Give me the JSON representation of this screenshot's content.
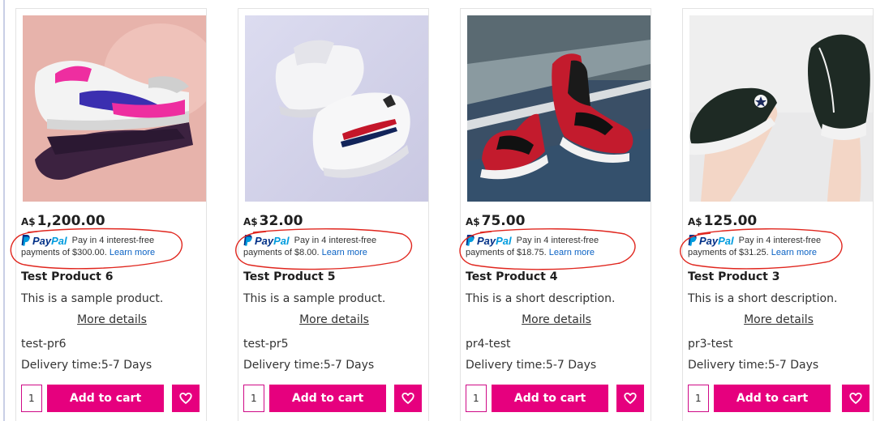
{
  "products": [
    {
      "price_currency": "A$",
      "price_amount": "1,200.00",
      "paypal_brand_pay": "Pay",
      "paypal_brand_pal": "Pal",
      "paypal_line1": "Pay in 4 interest-free",
      "paypal_line2": "payments of $300.00.",
      "paypal_learn": "Learn more",
      "name": "Test Product 6",
      "description": "This is a sample product.",
      "more_details": "More details",
      "sku": "test-pr6",
      "delivery": "Delivery time:5-7 Days",
      "quantity": "1",
      "add_to_cart": "Add to cart",
      "image": "pink-white-sneaker-on-hand"
    },
    {
      "price_currency": "A$",
      "price_amount": "32.00",
      "paypal_brand_pay": "Pay",
      "paypal_brand_pal": "Pal",
      "paypal_line1": "Pay in 4 interest-free",
      "paypal_line2": "payments of $8.00.",
      "paypal_learn": "Learn more",
      "name": "Test Product 5",
      "description": "This is a sample product.",
      "more_details": "More details",
      "sku": "test-pr5",
      "delivery": "Delivery time:5-7 Days",
      "quantity": "1",
      "add_to_cart": "Add to cart",
      "image": "white-sneakers-floating"
    },
    {
      "price_currency": "A$",
      "price_amount": "75.00",
      "paypal_brand_pay": "Pay",
      "paypal_brand_pal": "Pal",
      "paypal_line1": "Pay in 4 interest-free",
      "paypal_line2": "payments of $18.75.",
      "paypal_learn": "Learn more",
      "name": "Test Product 4",
      "description": "This is a short description.",
      "more_details": "More details",
      "sku": "pr4-test",
      "delivery": "Delivery time:5-7 Days",
      "quantity": "1",
      "add_to_cart": "Add to cart",
      "image": "red-black-sneakers-on-court"
    },
    {
      "price_currency": "A$",
      "price_amount": "125.00",
      "paypal_brand_pay": "Pay",
      "paypal_brand_pal": "Pal",
      "paypal_line1": "Pay in 4 interest-free",
      "paypal_line2": "payments of $31.25.",
      "paypal_learn": "Learn more",
      "name": "Test Product 3",
      "description": "This is a short description.",
      "more_details": "More details",
      "sku": "pr3-test",
      "delivery": "Delivery time:5-7 Days",
      "quantity": "1",
      "add_to_cart": "Add to cart",
      "image": "black-high-top-sneakers"
    }
  ],
  "icons": {
    "wishlist": "heart-icon",
    "paypal": "paypal-logo-icon"
  },
  "colors": {
    "accent": "#e6007e",
    "paypal_dark": "#003087",
    "paypal_light": "#009cde",
    "link": "#0a62c4",
    "annotation": "#e0261e"
  }
}
